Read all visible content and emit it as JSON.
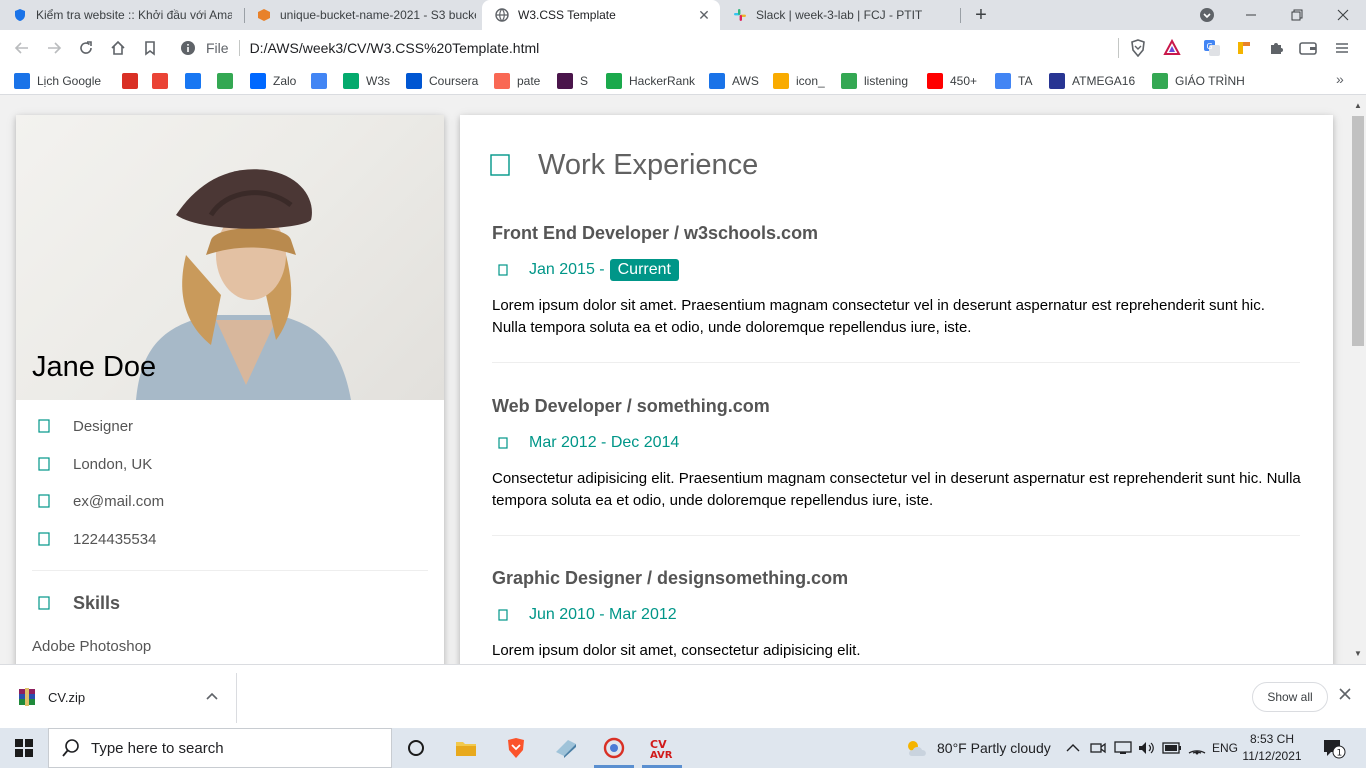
{
  "browser": {
    "tabs": [
      {
        "title": "Kiểm tra website :: Khởi đầu với Amaz",
        "icon": "shield-check-icon"
      },
      {
        "title": "unique-bucket-name-2021 - S3 bucke",
        "icon": "aws-s3-icon"
      },
      {
        "title": "W3.CSS Template",
        "icon": "globe-icon",
        "active": true
      },
      {
        "title": "Slack | week-3-lab | FCJ - PTIT",
        "icon": "slack-icon"
      }
    ],
    "address": {
      "scheme_label": "File",
      "url": "D:/AWS/week3/CV/W3.CSS%20Template.html"
    },
    "bookmarks": [
      {
        "label": "Lịch Google",
        "icon": "google-calendar-icon",
        "color": "#1a73e8"
      },
      {
        "label": "",
        "icon": "red-bookmark-icon",
        "color": "#d93025"
      },
      {
        "label": "",
        "icon": "gmail-icon",
        "color": "#ea4335"
      },
      {
        "label": "",
        "icon": "facebook-icon",
        "color": "#1877f2"
      },
      {
        "label": "",
        "icon": "google-drive-icon",
        "color": "#34a853"
      },
      {
        "label": "Zalo",
        "icon": "zalo-icon",
        "color": "#0068ff"
      },
      {
        "label": "",
        "icon": "translate-icon",
        "color": "#4285f4"
      },
      {
        "label": "W3s",
        "icon": "w3schools-icon",
        "color": "#04aa6d"
      },
      {
        "label": "Coursera",
        "icon": "coursera-icon",
        "color": "#0056d2"
      },
      {
        "label": "pate",
        "icon": "patreon-icon",
        "color": "#f96854"
      },
      {
        "label": "S",
        "icon": "slack-icon",
        "color": "#4a154b"
      },
      {
        "label": "HackerRank",
        "icon": "hackerrank-icon",
        "color": "#1ba94c"
      },
      {
        "label": "AWS",
        "icon": "aws-shield-icon",
        "color": "#1a73e8"
      },
      {
        "label": "icon_",
        "icon": "emoji-icon",
        "color": "#f9ab00"
      },
      {
        "label": "listening",
        "icon": "listening-icon",
        "color": "#34a853"
      },
      {
        "label": "450+",
        "icon": "youtube-icon",
        "color": "#ff0000"
      },
      {
        "label": "TA",
        "icon": "ta-icon",
        "color": "#4285f4"
      },
      {
        "label": "ATMEGA16",
        "icon": "pdf-icon",
        "color": "#283593"
      },
      {
        "label": "GIÁO TRÌNH",
        "icon": "google-drive-icon",
        "color": "#34a853"
      }
    ]
  },
  "profile": {
    "name": "Jane Doe",
    "info": [
      {
        "text": "Designer",
        "icon": "briefcase-icon"
      },
      {
        "text": "London, UK",
        "icon": "home-icon"
      },
      {
        "text": "ex@mail.com",
        "icon": "envelope-icon"
      },
      {
        "text": "1224435534",
        "icon": "phone-icon"
      }
    ],
    "skills_title": "Skills",
    "skills": [
      "Adobe Photoshop"
    ]
  },
  "work": {
    "title": "Work Experience",
    "jobs": [
      {
        "role": "Front End Developer / w3schools.com",
        "dates": "Jan 2015 -",
        "badge": "Current",
        "desc": "Lorem ipsum dolor sit amet. Praesentium magnam consectetur vel in deserunt aspernatur est reprehenderit sunt hic. Nulla tempora soluta ea et odio, unde doloremque repellendus iure, iste."
      },
      {
        "role": "Web Developer / something.com",
        "dates": "Mar 2012 - Dec 2014",
        "badge": "",
        "desc": "Consectetur adipisicing elit. Praesentium magnam consectetur vel in deserunt aspernatur est reprehenderit sunt hic. Nulla tempora soluta ea et odio, unde doloremque repellendus iure, iste."
      },
      {
        "role": "Graphic Designer / designsomething.com",
        "dates": "Jun 2010 - Mar 2012",
        "badge": "",
        "desc": "Lorem ipsum dolor sit amet, consectetur adipisicing elit."
      }
    ]
  },
  "downloads": {
    "file": "CV.zip",
    "show_all": "Show all"
  },
  "taskbar": {
    "search_placeholder": "Type here to search",
    "weather": "80°F  Partly cloudy",
    "language": "ENG",
    "time": "8:53 CH",
    "date": "11/12/2021",
    "notifications": "1"
  },
  "colors": {
    "accent": "#009688",
    "text_muted": "#555555"
  }
}
